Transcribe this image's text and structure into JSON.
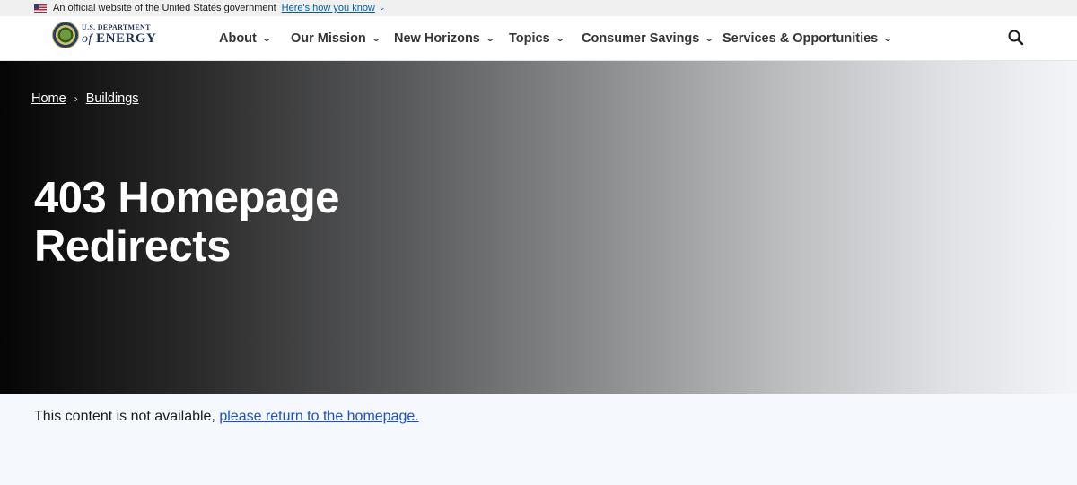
{
  "gov_banner": {
    "text": "An official website of the United States government",
    "link": "Here's how you know",
    "chevron": "⌄"
  },
  "logo": {
    "line1": "U.S. DEPARTMENT",
    "line2_prefix": "of",
    "line2": "ENERGY"
  },
  "nav": {
    "items": [
      {
        "label": "About"
      },
      {
        "label": "Our Mission"
      },
      {
        "label": "New Horizons"
      },
      {
        "label": "Topics"
      },
      {
        "label": "Consumer Savings"
      },
      {
        "label": "Services & Opportunities"
      }
    ],
    "chevron": "⌄",
    "search_icon": "search-icon"
  },
  "breadcrumb": {
    "items": [
      {
        "label": "Home"
      },
      {
        "label": "Buildings"
      }
    ],
    "separator": "›"
  },
  "hero": {
    "title": "403 Homepage Redirects"
  },
  "content": {
    "text": "This content is not available,",
    "link": "please return to the homepage."
  },
  "colors": {
    "link": "#1a4fd6",
    "gov_link": "#005ea2",
    "logo_text": "#1e2f55",
    "nav_text": "#343434"
  }
}
